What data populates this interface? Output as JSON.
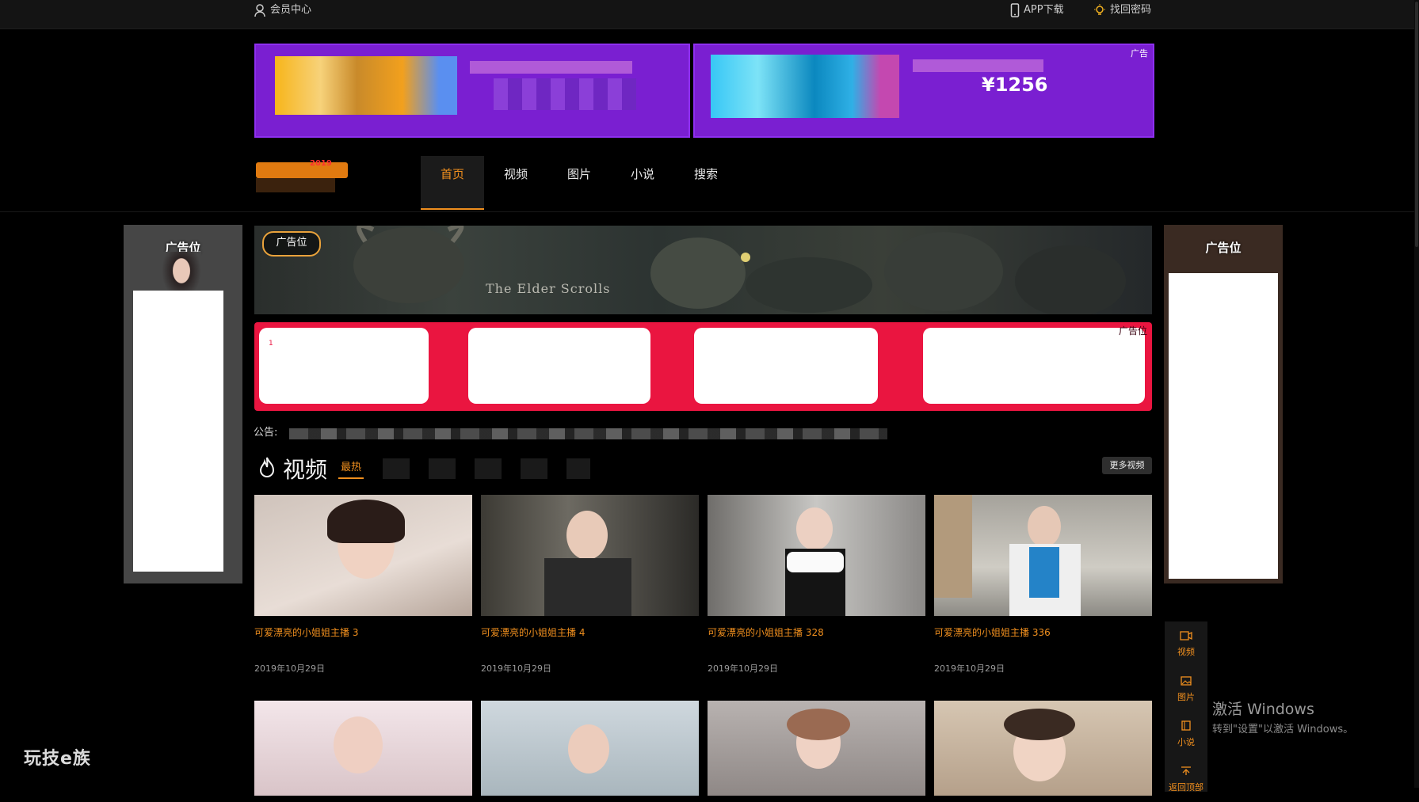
{
  "topbar": {
    "member_center": "会员中心",
    "app_download": "APP下载",
    "recover_password": "找回密码"
  },
  "banner": {
    "number_fragment": "¥1256",
    "corner_tag": "广告"
  },
  "logo": {
    "year": "2019"
  },
  "nav": {
    "tabs": [
      "首页",
      "视频",
      "图片",
      "小说",
      "搜索"
    ],
    "active": "首页"
  },
  "left_ad": {
    "label": "广告位"
  },
  "right_ad": {
    "label": "广告位"
  },
  "hero": {
    "tag": "广告位",
    "caption": "The Elder Scrolls"
  },
  "red_ad": {
    "corner": "广告位",
    "tiny": "1"
  },
  "notice": {
    "label": "公告:"
  },
  "video_section": {
    "title": "视频",
    "active_tab": "最热",
    "more_button": "更多视频",
    "cards": [
      {
        "title": "可爱漂亮的小姐姐主播 3",
        "date": "2019年10月29日"
      },
      {
        "title": "可爱漂亮的小姐姐主播 4",
        "date": "2019年10月29日"
      },
      {
        "title": "可爱漂亮的小姐姐主播 328",
        "date": "2019年10月29日"
      },
      {
        "title": "可爱漂亮的小姐姐主播 336",
        "date": "2019年10月29日"
      }
    ]
  },
  "float_bar": {
    "items": [
      {
        "label": "视频",
        "icon": "video-icon"
      },
      {
        "label": "图片",
        "icon": "image-icon"
      },
      {
        "label": "小说",
        "icon": "book-icon"
      },
      {
        "label": "返回顶部",
        "icon": "arrow-up-icon"
      }
    ]
  },
  "watermark": {
    "line1": "激活 Windows",
    "line2": "转到\"设置\"以激活 Windows。"
  },
  "brand": "玩技e族",
  "colors": {
    "accent": "#f08f1e",
    "banner_purple": "#7a1fd1",
    "ad_red": "#ea1540",
    "background": "#000000"
  }
}
